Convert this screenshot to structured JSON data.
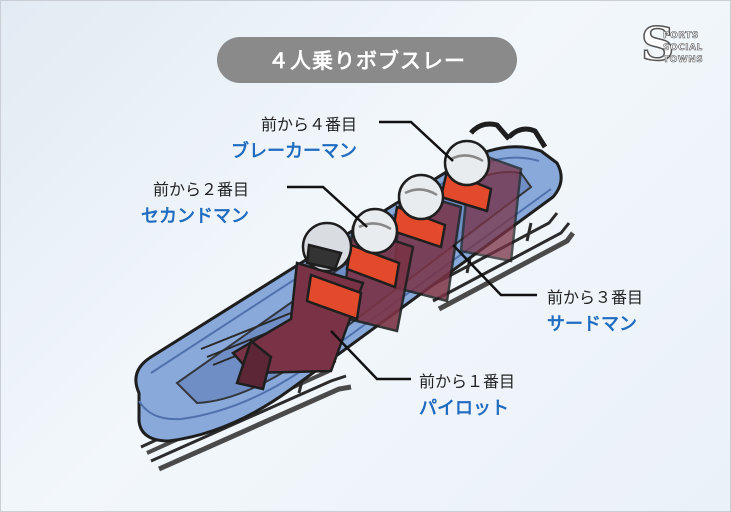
{
  "title": "４人乗りボブスレー",
  "logo": {
    "letter": "S",
    "words": [
      "PORTS",
      "SOCIAL",
      "TOWNS"
    ]
  },
  "labels": [
    {
      "position": "前から４番目",
      "role": "ブレーカーマン"
    },
    {
      "position": "前から２番目",
      "role": "セカンドマン"
    },
    {
      "position": "前から３番目",
      "role": "サードマン"
    },
    {
      "position": "前から１番目",
      "role": "パイロット"
    }
  ],
  "colors": {
    "sled": "#7fa2d6",
    "sled_dark": "#4f72ad",
    "label_role": "#1f6cc0",
    "suit": "#7a3346",
    "vest": "#e34a2c",
    "title_bg": "#8a8a8a"
  }
}
